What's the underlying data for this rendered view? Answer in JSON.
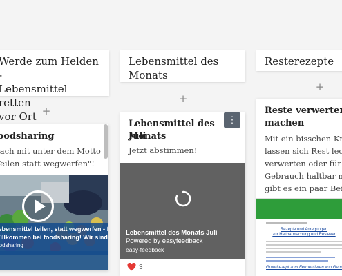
{
  "columns": [
    {
      "header": [
        "Werde zum Helden -",
        "Lebensmittel retten",
        "vor Ort"
      ],
      "card": {
        "title": "Foodsharing",
        "body": [
          "Mach mit unter dem Motto",
          "\"Teilen statt wegwerfen\"!"
        ],
        "video_title": [
          "Lebensmittel teilen, statt wegwerfen - fo...",
          "Willkommen bei foodsharing! Wir sind ei..."
        ],
        "video_source": "foodsharing"
      }
    },
    {
      "header": [
        "Lebensmittel des",
        "Monats"
      ],
      "card": {
        "title": [
          "Lebensmittel des Monats",
          "Juli"
        ],
        "body": "Jetzt abstimmen!",
        "embed_title": "Lebensmittel des Monats Juli",
        "embed_powered": "Powered by easyfeedback",
        "embed_source": "easy-feedback",
        "likes": "3"
      }
    },
    {
      "header": "Resterezepte",
      "card": {
        "title": [
          "Reste verwerten und",
          "machen"
        ],
        "body": [
          "Mit ein bisschen Kreativ",
          "lassen sich Rest lecker w",
          "verwerten oder für den s",
          "Gebrauch haltbar mache",
          "gibt es ein paar Beispiel:"
        ],
        "doc_heading": [
          "Rezepte und Anregungen",
          "zur Haltbarmachung und Restever"
        ],
        "doc_footer": "Grundrezept zum Fermentieren von Gemüse"
      }
    }
  ],
  "plus_label": "+",
  "menu_label": "⋮",
  "colors": {
    "video_caption_text": "#ffffff",
    "embed_bg": "#616161",
    "heart": "#e53935",
    "doc_green": "#2e9d3a"
  }
}
